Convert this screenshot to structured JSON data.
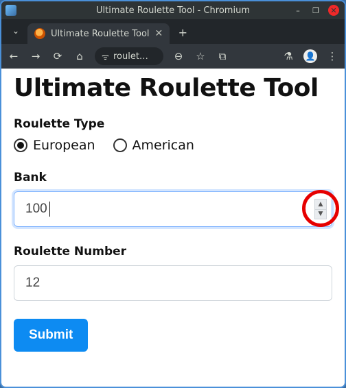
{
  "window": {
    "title": "Ultimate Roulette Tool - Chromium",
    "controls": {
      "minimize": "–",
      "maximize": "❐",
      "close": "✕"
    }
  },
  "tabs": {
    "search_toggle": "⌄",
    "active": {
      "title": "Ultimate Roulette Tool",
      "close": "✕"
    },
    "newtab": "+"
  },
  "navbar": {
    "back": "←",
    "forward": "→",
    "reload": "⟳",
    "home": "⌂",
    "omnibox": {
      "site_icon": "ᯤ",
      "text": "roulet…"
    },
    "zoom": "⊖",
    "star": "☆",
    "ext": "⧉",
    "labs": "⚗",
    "avatar": "👤",
    "menu": "⋮"
  },
  "page": {
    "title": "Ultimate Roulette Tool",
    "roulette_type": {
      "label": "Roulette Type",
      "options": [
        {
          "value": "european",
          "label": "European",
          "selected": true
        },
        {
          "value": "american",
          "label": "American",
          "selected": false
        }
      ]
    },
    "bank": {
      "label": "Bank",
      "value": "100",
      "focused": true
    },
    "roulette_number": {
      "label": "Roulette Number",
      "value": "12",
      "focused": false
    },
    "submit": "Submit"
  },
  "annotation": {
    "target": "bank-spinner"
  }
}
